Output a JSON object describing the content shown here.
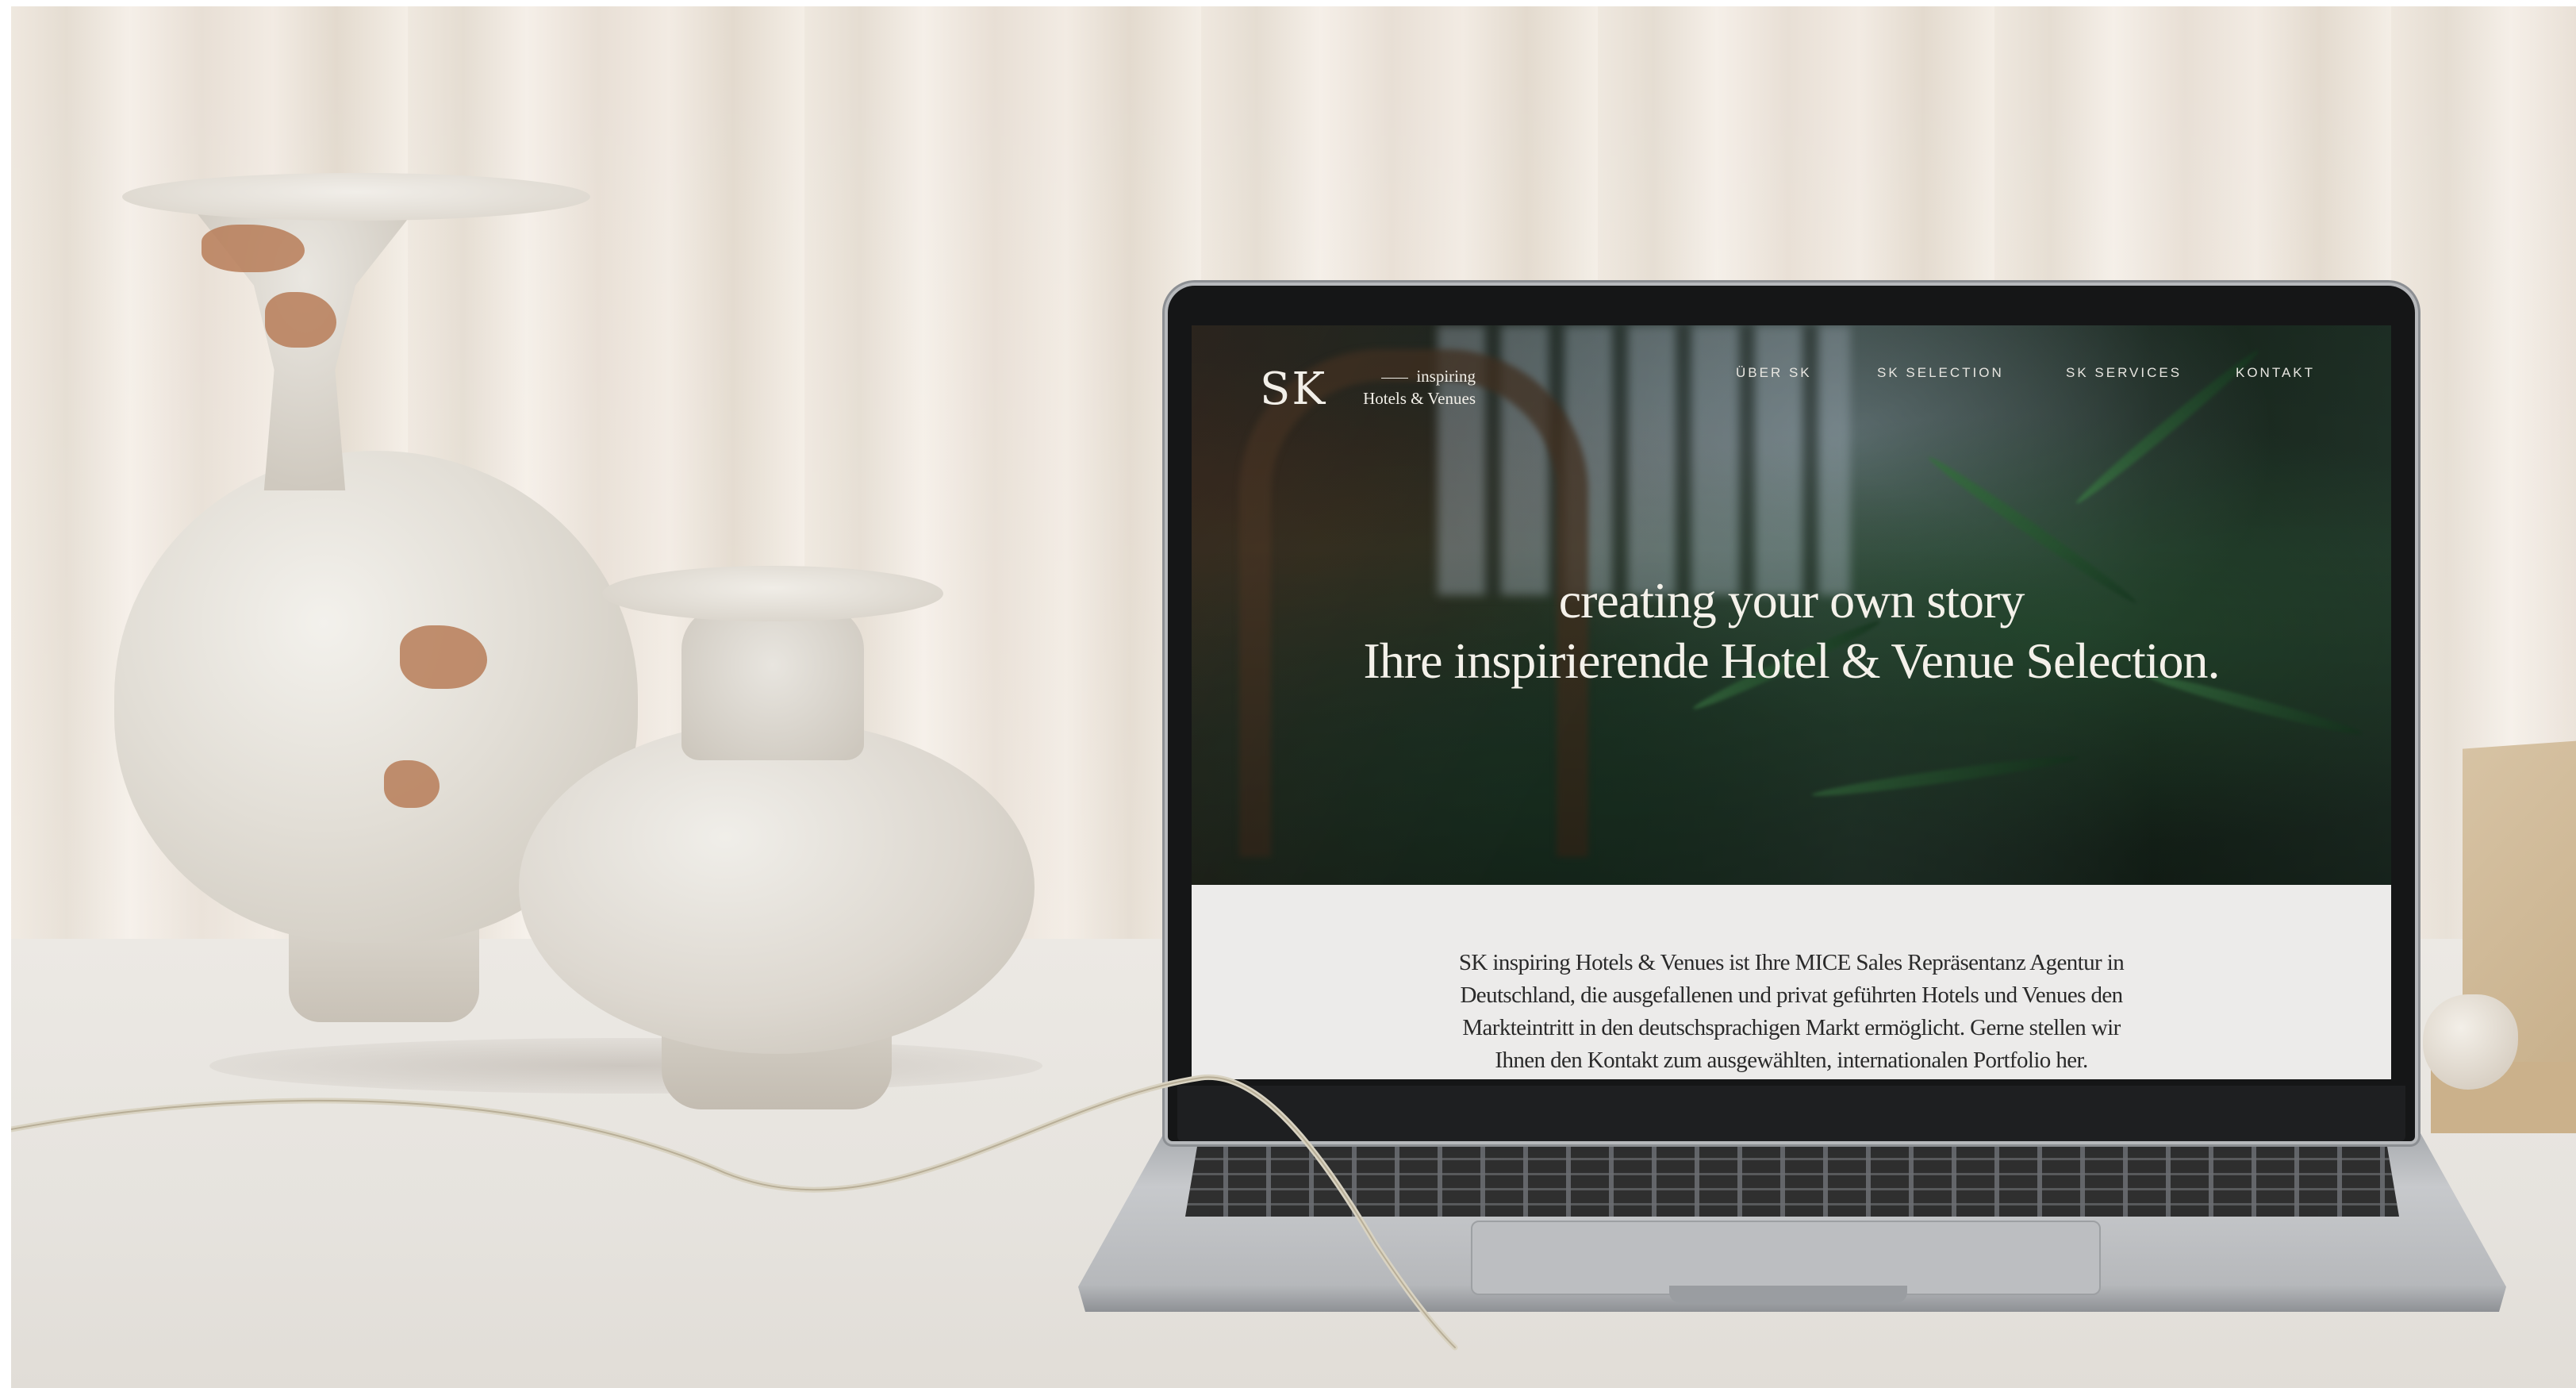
{
  "website": {
    "logo": {
      "mark": "SK",
      "line1": "inspiring",
      "line2": "Hotels & Venues"
    },
    "nav": [
      {
        "label": "ÜBER SK"
      },
      {
        "label": "SK SELECTION"
      },
      {
        "label": "SK SERVICES"
      },
      {
        "label": "KONTAKT"
      }
    ],
    "hero": {
      "line1": "creating your own story",
      "line2": "Ihre inspirierende Hotel & Venue Selection."
    },
    "intro": {
      "lines": [
        "SK inspiring Hotels & Venues ist Ihre MICE Sales Repräsentanz Agentur in",
        "Deutschland, die ausgefallenen und privat geführten Hotels und Venues den",
        "Markteintritt in den deutschsprachigen Markt ermöglicht. Gerne stellen wir",
        "Ihnen den Kontakt zum ausgewählten, internationalen Portfolio her."
      ]
    }
  },
  "colors": {
    "curtain": "#ece4da",
    "tablecloth": "#e7e4df",
    "laptop_bezel": "#151617",
    "laptop_body": "#c0c2c5",
    "intro_background": "#ecebea",
    "hero_text": "#f4f1ea"
  }
}
